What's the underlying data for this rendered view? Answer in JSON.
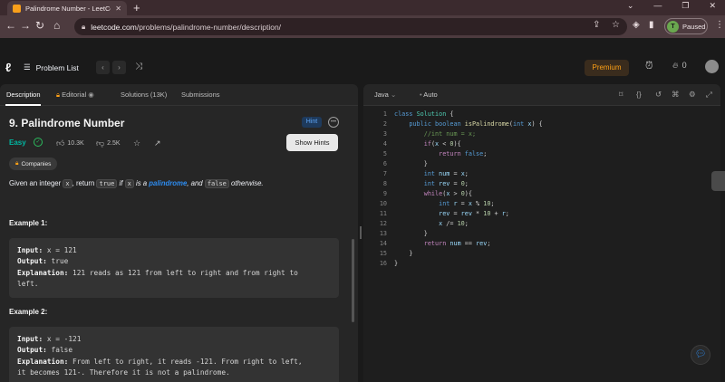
{
  "browser": {
    "tab_title": "Palindrome Number - LeetCode",
    "tab_close": "✕",
    "new_tab": "+",
    "url_domain": "leetcode.com",
    "url_path": "/problems/palindrome-number/description/",
    "profile_initial": "T",
    "profile_status": "Paused",
    "win_min": "⌄",
    "win_minimize": "—",
    "win_max": "❐",
    "win_close": "✕"
  },
  "header": {
    "problem_list": "Problem List",
    "premium": "Premium",
    "streak_count": "0"
  },
  "left": {
    "tabs": {
      "description": "Description",
      "editorial": "Editorial",
      "solutions": "Solutions (13K)",
      "submissions": "Submissions"
    },
    "title": "9. Palindrome Number",
    "hint_badge": "Hint",
    "difficulty": "Easy",
    "likes": "10.3K",
    "dislikes": "2.5K",
    "show_hints": "Show Hints",
    "companies": "Companies",
    "desc": {
      "p1": "Given an integer ",
      "c1": "x",
      "p2": ", return ",
      "c2": "true",
      "p3": " if ",
      "c3": "x",
      "p4": " is a ",
      "link": "palindrome",
      "p5": ", and ",
      "c4": "false",
      "p6": " otherwise."
    },
    "example1": {
      "heading": "Example 1:",
      "input_label": "Input:",
      "input": " x = 121",
      "output_label": "Output:",
      "output": " true",
      "expl_label": "Explanation:",
      "expl1": " 121 reads as 121 from left to right and from right to",
      "expl2": "left."
    },
    "example2": {
      "heading": "Example 2:",
      "input_label": "Input:",
      "input": " x = -121",
      "output_label": "Output:",
      "output": " false",
      "expl_label": "Explanation:",
      "expl1": " From left to right, it reads -121. From right to left,",
      "expl2": "it becomes 121-. Therefore it is not a palindrome."
    }
  },
  "editor": {
    "language": "Java",
    "mode": "Auto",
    "line_numbers": [
      "1",
      "2",
      "3",
      "4",
      "5",
      "6",
      "7",
      "8",
      "9",
      "10",
      "11",
      "12",
      "13",
      "14",
      "15",
      "16"
    ]
  }
}
